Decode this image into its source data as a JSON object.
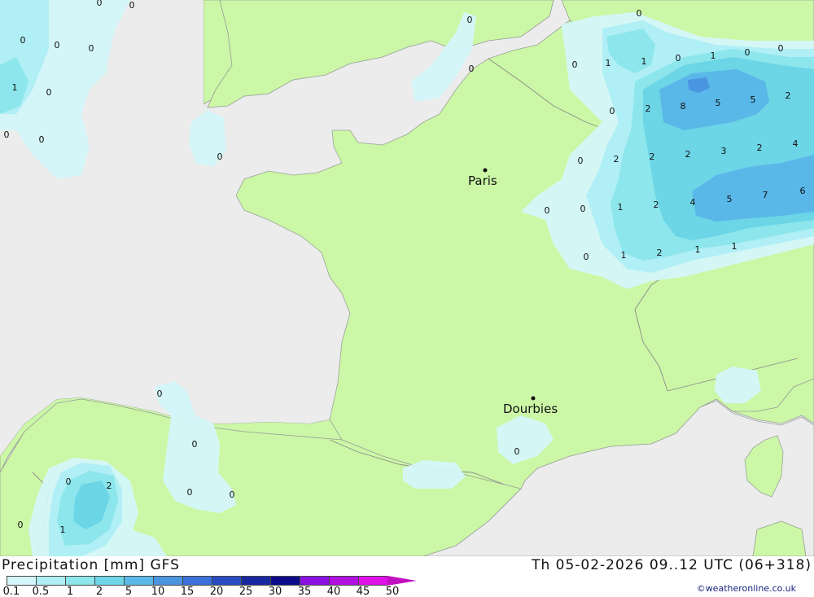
{
  "map": {
    "colors": {
      "sea": "#ececec",
      "land": "#ccf7a6",
      "border": "#999999"
    },
    "cities": [
      {
        "name": "Paris"
      },
      {
        "name": "Dourbies"
      }
    ],
    "contour_values": [
      0,
      0,
      0,
      0,
      1,
      0,
      0,
      0,
      0,
      0,
      0,
      0,
      0,
      0,
      1,
      1,
      0,
      1,
      0,
      0,
      0,
      2,
      8,
      5,
      5,
      2,
      0,
      2,
      2,
      2,
      3,
      2,
      4,
      0,
      0,
      1,
      2,
      4,
      5,
      7,
      6,
      0,
      1,
      2,
      1,
      1,
      0,
      0,
      0,
      0,
      0,
      2,
      0,
      1,
      0
    ]
  },
  "footer": {
    "title": "Precipitation [mm] GFS",
    "run_info": "Th 05-02-2026 09..12 UTC (06+318)",
    "credit": "©weatheronline.co.uk"
  },
  "legend": {
    "labels": [
      "0.1",
      "0.5",
      "1",
      "2",
      "5",
      "10",
      "15",
      "20",
      "25",
      "30",
      "35",
      "40",
      "45",
      "50"
    ],
    "colors": [
      "#d4f7fa",
      "#b0eff5",
      "#8ce6ec",
      "#6cd5e6",
      "#5ab8e8",
      "#4a94e0",
      "#3a70d8",
      "#2a4cc0",
      "#1a28a0",
      "#0c0c88",
      "#8a10e0",
      "#b010e0",
      "#e010e8",
      "#c010c0",
      "#a010a8"
    ]
  }
}
